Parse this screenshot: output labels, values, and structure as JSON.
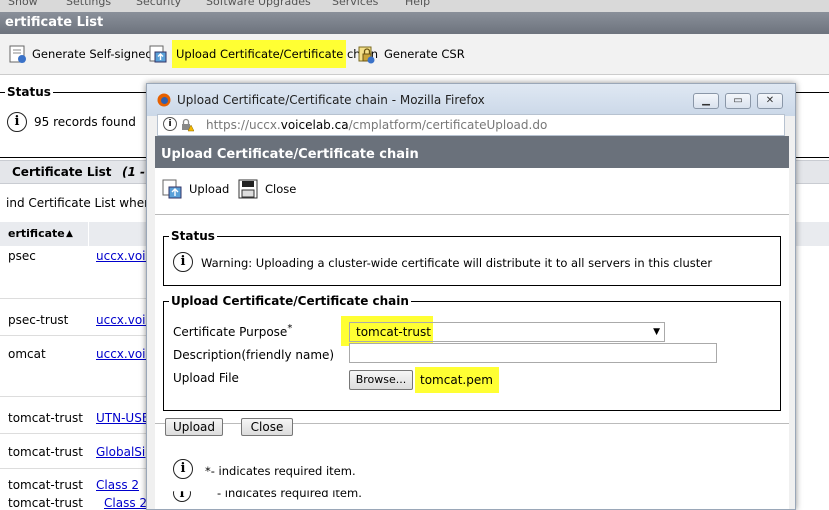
{
  "menu": {
    "items": [
      "Show",
      "Settings",
      "Security",
      "Software Upgrades",
      "Services",
      "Help"
    ]
  },
  "page": {
    "title": "ertificate List",
    "toolbar": {
      "generate_self_signed": "Generate Self-signed",
      "upload_chain": "Upload Certificate/Certificate chain",
      "generate_csr": "Generate CSR"
    },
    "status": {
      "legend": "Status",
      "message": "95 records found"
    },
    "list": {
      "header": "Certificate List",
      "range": "(1 -",
      "find_label": "ind Certificate List where",
      "column_certificate": "ertificate",
      "rows": [
        {
          "name": "psec",
          "link": "uccx.voic"
        },
        {
          "name": "psec-trust",
          "link": "uccx.voic"
        },
        {
          "name": "omcat",
          "link": "uccx.voic"
        },
        {
          "name": "tomcat-trust",
          "link": "UTN-USE"
        },
        {
          "name": "tomcat-trust",
          "link": "GlobalSig"
        },
        {
          "name": "tomcat-trust",
          "link": "Class 2"
        },
        {
          "name": "tomcat-trust",
          "link": "Class 2"
        }
      ]
    }
  },
  "popup": {
    "window_title": "Upload Certificate/Certificate chain - Mozilla Firefox",
    "url_prefix": "https://uccx.",
    "url_domain": "voicelab.ca",
    "url_path": "/cmplatform/certificateUpload.do",
    "header": "Upload Certificate/Certificate chain",
    "toolbar": {
      "upload": "Upload",
      "close": "Close"
    },
    "status": {
      "legend": "Status",
      "message": "Warning: Uploading a cluster-wide certificate will distribute it to all servers in this cluster"
    },
    "form": {
      "legend": "Upload Certificate/Certificate chain",
      "purpose_label": "Certificate Purpose",
      "required_mark": "*",
      "purpose_value": "tomcat-trust",
      "description_label": "Description(friendly name)",
      "description_value": "",
      "file_label": "Upload File",
      "browse_label": "Browse...",
      "file_value": "tomcat.pem"
    },
    "buttons": {
      "upload": "Upload",
      "close": "Close"
    },
    "note": "*- indicates required item.",
    "note_behind": "- indicates required item."
  },
  "colors": {
    "highlight": "#ffff33",
    "header_gray": "#6a717b",
    "link": "#0000cc"
  }
}
